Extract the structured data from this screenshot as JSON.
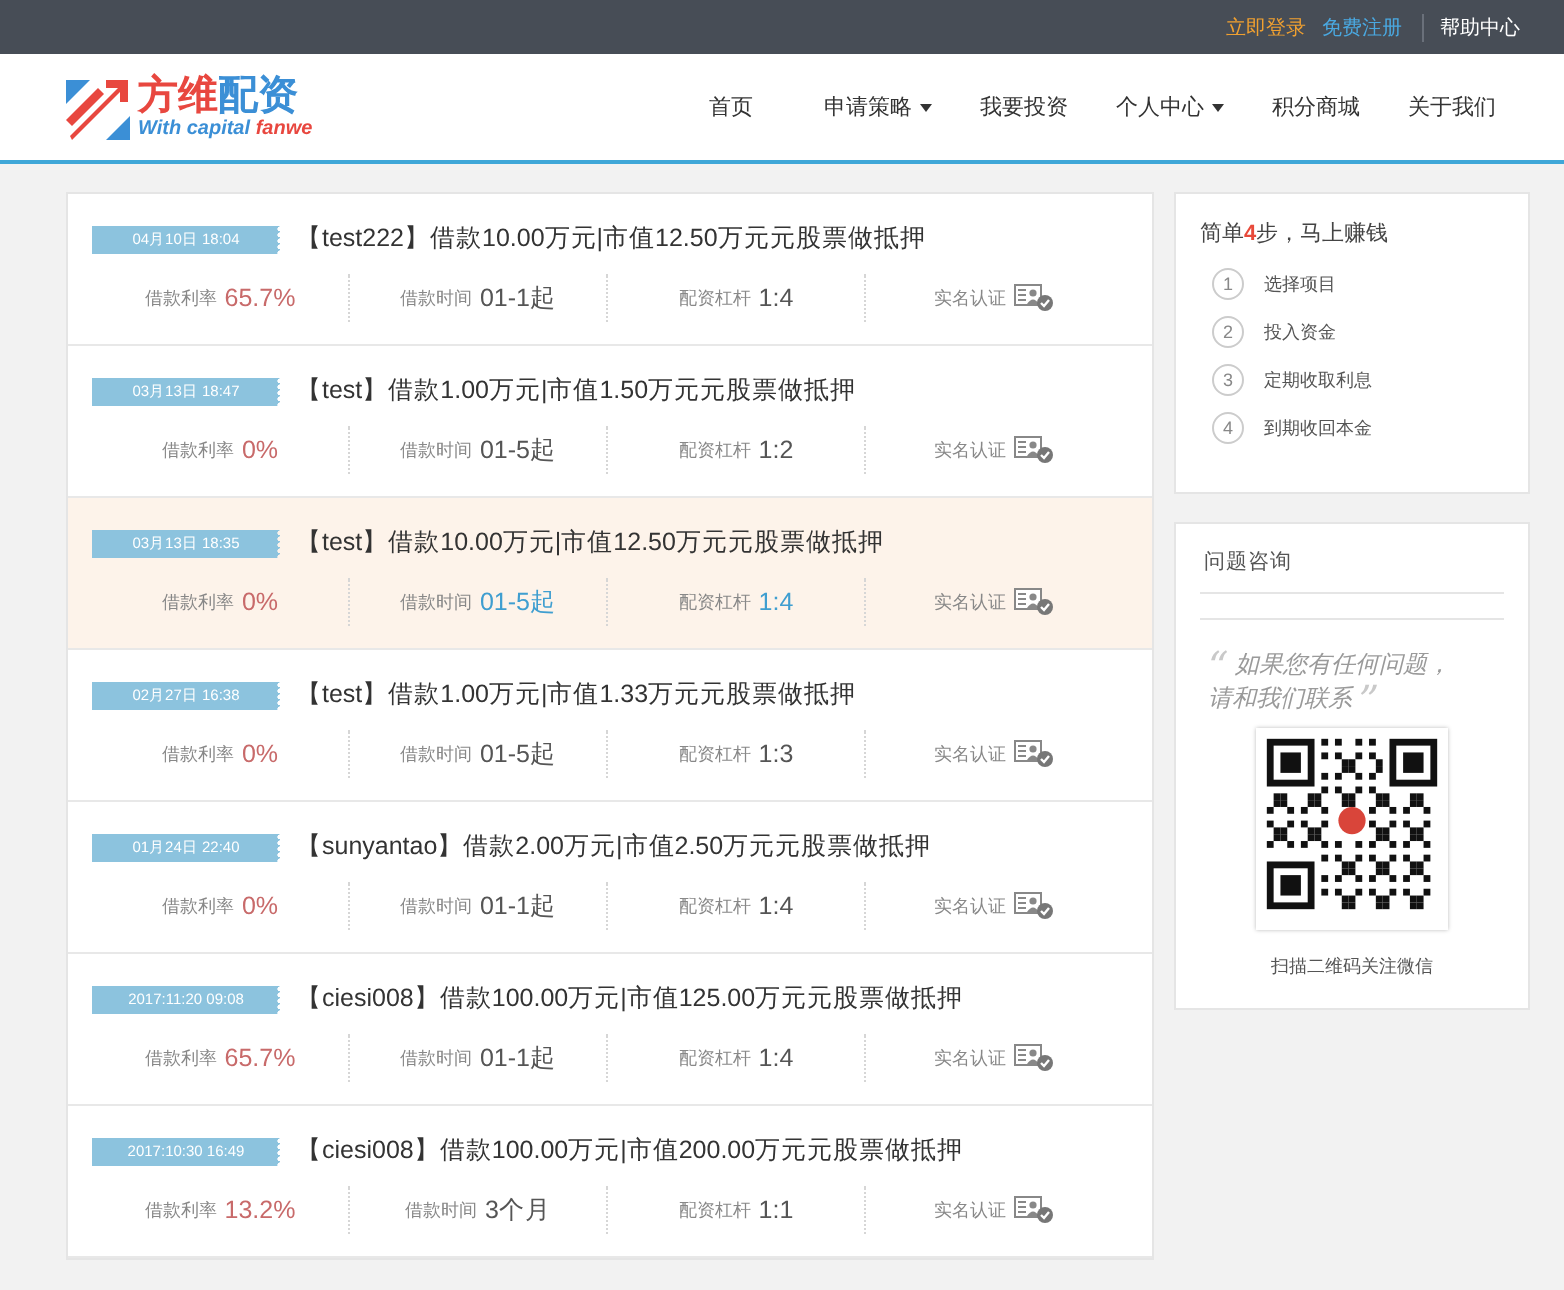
{
  "top_links": [
    {
      "label": "立即登录",
      "color": "#f0a030"
    },
    {
      "label": "免费注册",
      "color": "#4aa8e0"
    },
    {
      "label": "帮助中心",
      "color": "#ffffff"
    }
  ],
  "logo": {
    "title": [
      "方维",
      "配资"
    ],
    "tagline": [
      "With capital ",
      "fanwe"
    ]
  },
  "nav": [
    {
      "label": "首页",
      "dropdown": false
    },
    {
      "label": "申请策略",
      "dropdown": true
    },
    {
      "label": "我要投资",
      "dropdown": false
    },
    {
      "label": "个人中心",
      "dropdown": true
    },
    {
      "label": "积分商城",
      "dropdown": false
    },
    {
      "label": "关于我们",
      "dropdown": false
    }
  ],
  "loans": [
    {
      "date": "04月10日 18:04",
      "title": "【test222】借款10.00万元|市值12.50万元元股票做抵押",
      "rate_label": "借款利率",
      "rate": "65.7%",
      "term_label": "借款时间",
      "term": "01-1起",
      "leverage_label": "配资杠杆",
      "leverage": "1:4",
      "verify_label": "实名认证",
      "selected": false
    },
    {
      "date": "03月13日 18:47",
      "title": "【test】借款1.00万元|市值1.50万元元股票做抵押",
      "rate_label": "借款利率",
      "rate": "0%",
      "term_label": "借款时间",
      "term": "01-5起",
      "leverage_label": "配资杠杆",
      "leverage": "1:2",
      "verify_label": "实名认证",
      "selected": false
    },
    {
      "date": "03月13日 18:35",
      "title": "【test】借款10.00万元|市值12.50万元元股票做抵押",
      "rate_label": "借款利率",
      "rate": "0%",
      "term_label": "借款时间",
      "term": "01-5起",
      "leverage_label": "配资杠杆",
      "leverage": "1:4",
      "verify_label": "实名认证",
      "selected": true
    },
    {
      "date": "02月27日 16:38",
      "title": "【test】借款1.00万元|市值1.33万元元股票做抵押",
      "rate_label": "借款利率",
      "rate": "0%",
      "term_label": "借款时间",
      "term": "01-5起",
      "leverage_label": "配资杠杆",
      "leverage": "1:3",
      "verify_label": "实名认证",
      "selected": false
    },
    {
      "date": "01月24日 22:40",
      "title": "【sunyantao】借款2.00万元|市值2.50万元元股票做抵押",
      "rate_label": "借款利率",
      "rate": "0%",
      "term_label": "借款时间",
      "term": "01-1起",
      "leverage_label": "配资杠杆",
      "leverage": "1:4",
      "verify_label": "实名认证",
      "selected": false
    },
    {
      "date": "2017:11:20 09:08",
      "title": "【ciesi008】借款100.00万元|市值125.00万元元股票做抵押",
      "rate_label": "借款利率",
      "rate": "65.7%",
      "term_label": "借款时间",
      "term": "01-1起",
      "leverage_label": "配资杠杆",
      "leverage": "1:4",
      "verify_label": "实名认证",
      "selected": false
    },
    {
      "date": "2017:10:30 16:49",
      "title": "【ciesi008】借款100.00万元|市值200.00万元元股票做抵押",
      "rate_label": "借款利率",
      "rate": "13.2%",
      "term_label": "借款时间",
      "term": "3个月",
      "leverage_label": "配资杠杆",
      "leverage": "1:1",
      "verify_label": "实名认证",
      "selected": false
    }
  ],
  "steps_card": {
    "heading": [
      "简单",
      "4",
      "步，马上赚钱"
    ],
    "steps": [
      {
        "number": "1",
        "label": "选择项目"
      },
      {
        "number": "2",
        "label": "投入资金"
      },
      {
        "number": "3",
        "label": "定期收取利息"
      },
      {
        "number": "4",
        "label": "到期收回本金"
      }
    ]
  },
  "contact_card": {
    "title": "问题咨询",
    "quote_open": "“",
    "quote": "如果您有任何问题，请和我们联系",
    "quote_close": "”",
    "qr_caption": "扫描二维码关注微信"
  }
}
